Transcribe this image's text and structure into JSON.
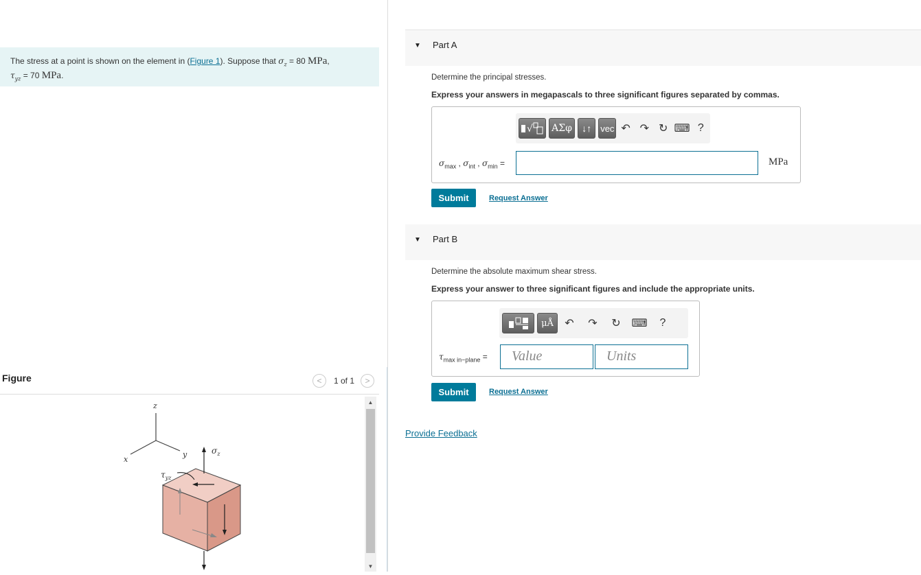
{
  "problem": {
    "intro": "The stress at a point is shown on the element in (",
    "figure_link": "Figure 1",
    "mid": "). Suppose that ",
    "sigma_sym": "σ",
    "sigma_sub": "z",
    "eq1": " = 80 ",
    "unit1": "MPa",
    "comma": ",",
    "tau_sym": "τ",
    "tau_sub": "yz",
    "eq2": " = 70 ",
    "unit2": "MPa",
    "period": "."
  },
  "figure": {
    "title": "Figure",
    "prev_label": "<",
    "next_label": ">",
    "count": "1 of 1",
    "axis_z": "z",
    "axis_y": "y",
    "axis_x": "x",
    "sigma_label": "σ",
    "sigma_sub": "z",
    "tau_label": "τ",
    "tau_sub": "yz"
  },
  "partA": {
    "title": "Part A",
    "question": "Determine the principal stresses.",
    "instruction": "Express your answers in megapascals to three significant figures separated by commas.",
    "toolbar": [
      "template-icon",
      "greek-ΑΣφ",
      "sort-icon",
      "vec",
      "undo-icon",
      "redo-icon",
      "reset-icon",
      "keyboard-icon",
      "help-icon"
    ],
    "greek_label": "ΑΣφ",
    "sort_label": "↓↑",
    "vec_label": "vec",
    "help_label": "?",
    "label_sigma": "σ",
    "label_max": "max",
    "label_int": "int",
    "label_min": "min",
    "label_sep": " , ",
    "label_eq": " =",
    "unit": "MPa",
    "submit": "Submit",
    "request": "Request Answer"
  },
  "partB": {
    "title": "Part B",
    "question": "Determine the absolute maximum shear stress.",
    "instruction": "Express your answer to three significant figures and include the appropriate units.",
    "mu_label": "μÅ",
    "help_label": "?",
    "label_tau": "τ",
    "label_sub": "max in−plane",
    "label_eq": " =",
    "value_placeholder": "Value",
    "units_placeholder": "Units",
    "submit": "Submit",
    "request": "Request Answer"
  },
  "feedback": "Provide Feedback",
  "colors": {
    "accent": "#007b9b",
    "link": "#0b6f93",
    "problem_bg": "#e6f4f5",
    "cube": "#e8b3a6"
  }
}
